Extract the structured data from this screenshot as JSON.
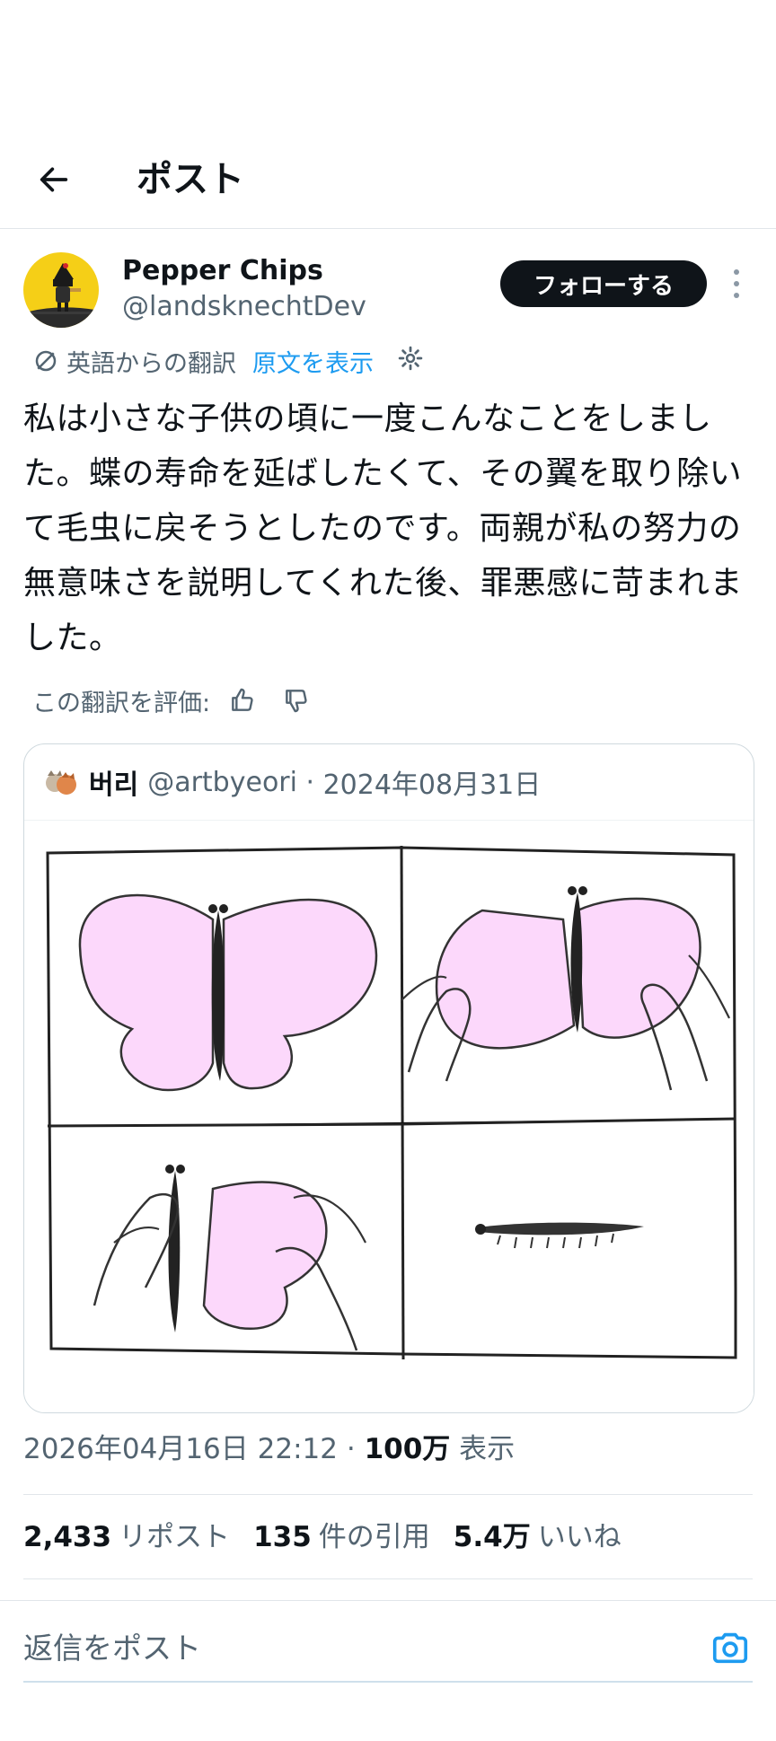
{
  "header": {
    "title": "ポスト",
    "back_icon": "arrow-left-icon"
  },
  "post": {
    "author_name": "Pepper Chips",
    "author_handle": "@landsknechtDev",
    "follow_label": "フォローする",
    "translation": {
      "from_label": "英語からの翻訳",
      "show_original_label": "原文を表示"
    },
    "text": "私は小さな子供の頃に一度こんなことをしました。蝶の寿命を延ばしたくて、その翼を取り除いて毛虫に戻そうとしたのです。両親が私の努力の無意味さを説明してくれた後、罪悪感に苛まれました。",
    "rate_label": "この翻訳を評価:",
    "quoted": {
      "name": "버리",
      "handle": "@artbyeori",
      "date": "2024年08月31日"
    },
    "timestamp": "2026年04月16日 22:12",
    "views_count": "100万",
    "views_label": "表示",
    "stats": {
      "reposts_count": "2,433",
      "reposts_label": "リポスト",
      "quotes_count": "135",
      "quotes_label": "件の引用",
      "likes_count": "5.4万",
      "likes_label": "いいね"
    }
  },
  "reply": {
    "placeholder": "返信をポスト"
  },
  "colors": {
    "link": "#1d9bf0",
    "wing": "#fcd8fb",
    "text": "#0f1419",
    "muted": "#536471"
  }
}
